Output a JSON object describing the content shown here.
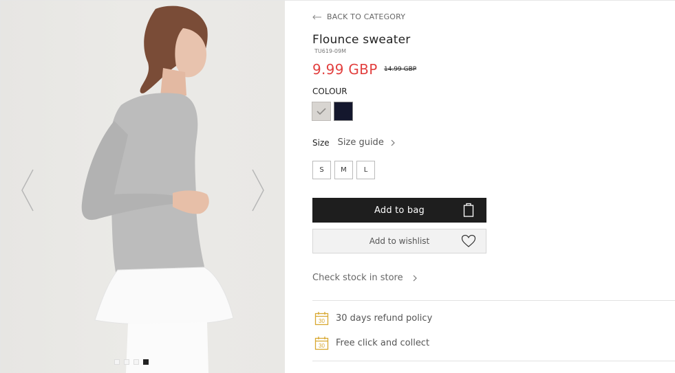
{
  "nav": {
    "back_label": "BACK TO CATEGORY"
  },
  "product": {
    "title": "Flounce sweater",
    "sku": "TU619-09M",
    "price_current": "9.99 GBP",
    "price_old": "14.99 GBP"
  },
  "colour": {
    "label": "COLOUR",
    "options": [
      {
        "name": "grey",
        "hex": "#d8d5d1",
        "selected": true
      },
      {
        "name": "navy",
        "hex": "#14172d",
        "selected": false
      }
    ]
  },
  "size": {
    "label": "Size",
    "guide_label": "Size guide",
    "options": [
      "S",
      "M",
      "L"
    ]
  },
  "actions": {
    "add_to_bag": "Add to bag",
    "add_to_wishlist": "Add to wishlist",
    "check_stock": "Check stock in store"
  },
  "benefits": [
    {
      "icon": "calendar-30-icon",
      "badge": "30",
      "text": "30 days refund policy"
    },
    {
      "icon": "calendar-30-icon",
      "badge": "30",
      "text": "Free click and collect"
    }
  ],
  "gallery": {
    "slides": 4,
    "active_slide": 4
  },
  "colors": {
    "sale_red": "#e2403f",
    "button_dark": "#1e1e1e",
    "accent_gold": "#d8a72f"
  }
}
